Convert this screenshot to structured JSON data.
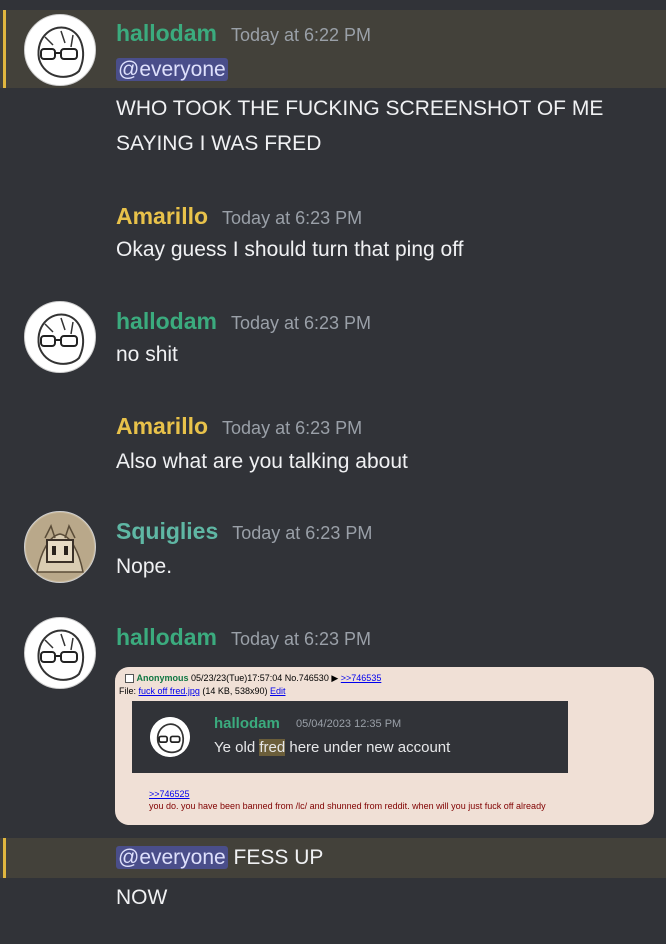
{
  "colors": {
    "background": "#313338",
    "mention_highlight": "#43413a",
    "mention_bar": "#e0b63f",
    "hallodam": "#3bab7e",
    "amarillo": "#e8c24a",
    "squiglies": "#5fb7a4"
  },
  "messages": [
    {
      "author": "hallodam",
      "timestamp": "Today at 6:22 PM",
      "mention": "@everyone",
      "lines": [
        "WHO TOOK THE FUCKING SCREENSHOT OF ME",
        "SAYING I WAS FRED"
      ],
      "avatar_icon": "glasses-character-avatar-icon"
    },
    {
      "author": "Amarillo",
      "timestamp": "Today at 6:23 PM",
      "lines": [
        "Okay guess I should turn that ping off"
      ]
    },
    {
      "author": "hallodam",
      "timestamp": "Today at 6:23 PM",
      "lines": [
        "no shit"
      ],
      "avatar_icon": "glasses-character-avatar-icon"
    },
    {
      "author": "Amarillo",
      "timestamp": "Today at 6:23 PM",
      "lines": [
        "Also what are you talking about"
      ]
    },
    {
      "author": "Squiglies",
      "timestamp": "Today at 6:23 PM",
      "lines": [
        "Nope."
      ],
      "avatar_icon": "box-character-avatar-icon"
    },
    {
      "author": "hallodam",
      "timestamp": "Today at 6:23 PM",
      "avatar_icon": "glasses-character-avatar-icon",
      "attachment": {
        "post_author": "Anonymous",
        "post_meta": "05/23/23(Tue)17:57:04 No.746530",
        "reply_link": ">>746535",
        "file_prefix": "File:",
        "file_name": "fuck off fred.jpg",
        "file_info": "(14 KB, 538x90)",
        "edit_link": "Edit",
        "screenshot": {
          "author": "hallodam",
          "timestamp": "05/04/2023 12:35 PM",
          "text_before": "Ye old ",
          "highlight": "fred",
          "text_after": " here under new account"
        },
        "quote_link": ">>746525",
        "body": "you do. you have been banned from /lc/ and shunned from reddit. when will you just fuck off already"
      }
    },
    {
      "mention": "@everyone",
      "text_after_mention": " FESS UP",
      "lines": [
        "NOW"
      ]
    }
  ]
}
